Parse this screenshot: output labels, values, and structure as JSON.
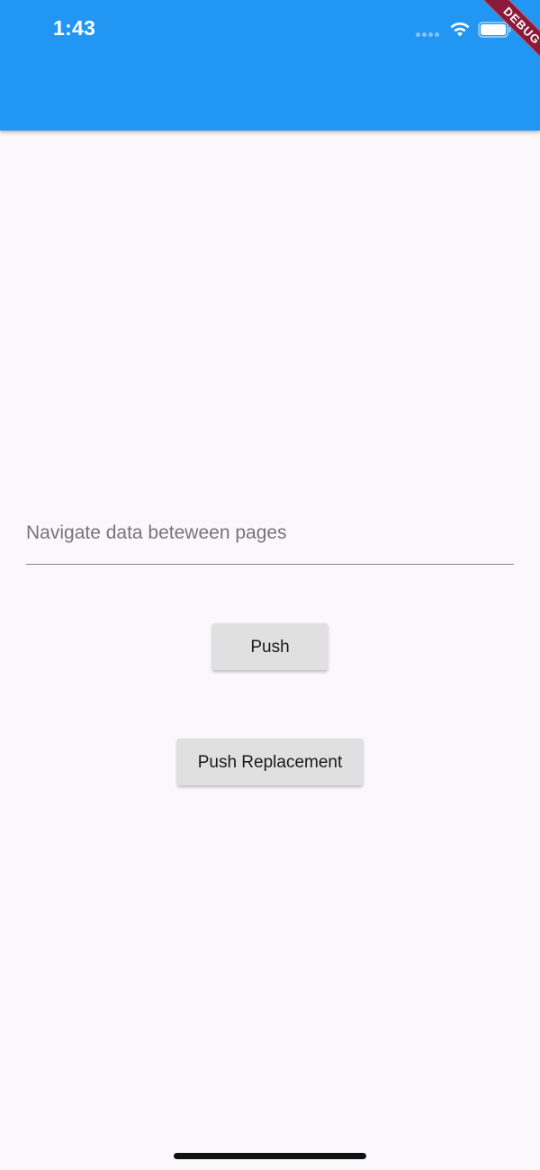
{
  "status_bar": {
    "time": "1:43",
    "icons": [
      "signal-dots-icon",
      "wifi-icon",
      "battery-icon"
    ]
  },
  "debug_banner": {
    "label": "DEBUG",
    "color": "#8b1a3a"
  },
  "app_bar": {
    "color": "#2196f3"
  },
  "form": {
    "input_value": "",
    "input_placeholder": "Navigate data beteween pages"
  },
  "buttons": {
    "push_label": "Push",
    "push_replacement_label": "Push Replacement"
  },
  "colors": {
    "background": "#faf8fb",
    "button": "#e0e0e0"
  }
}
